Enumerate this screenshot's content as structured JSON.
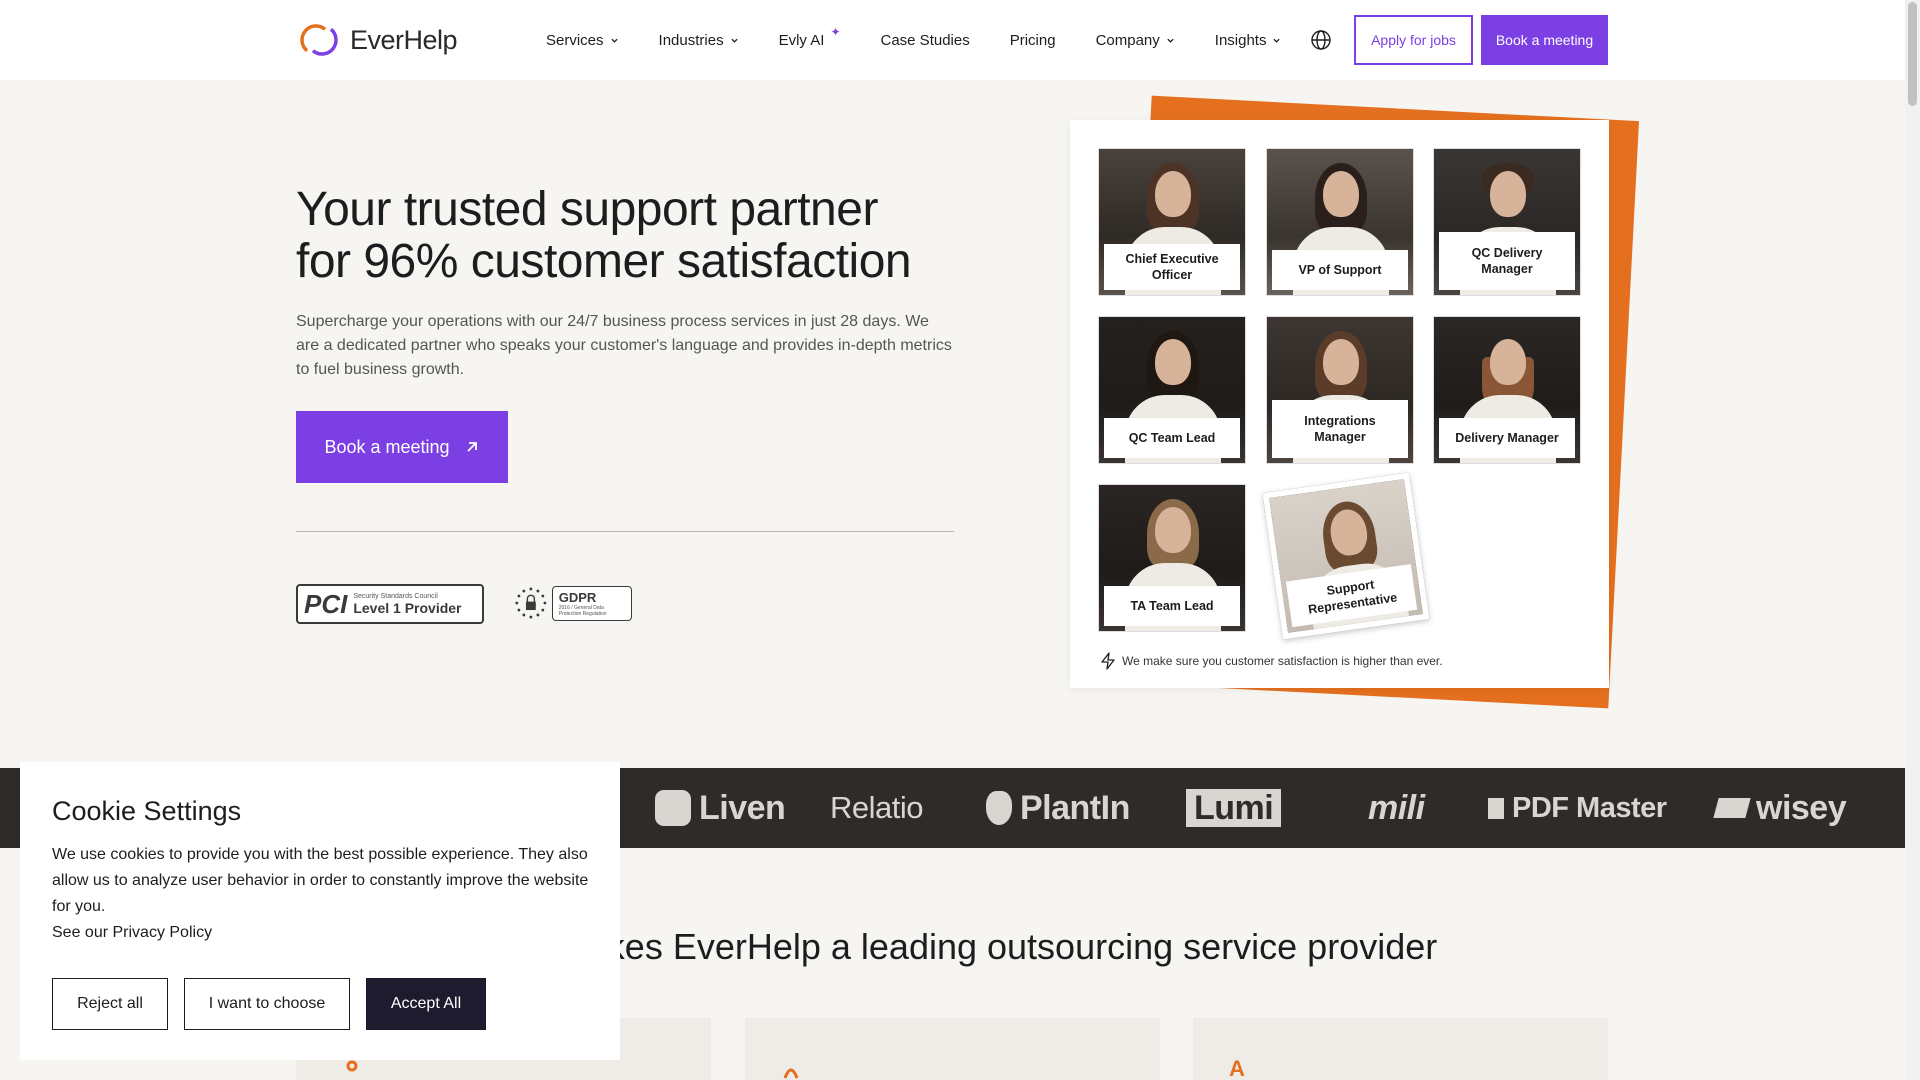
{
  "brand": {
    "name": "EverHelp",
    "accent": "#7b3fe4",
    "orange": "#e4701f"
  },
  "nav": {
    "items": [
      {
        "label": "Services",
        "dropdown": true
      },
      {
        "label": "Industries",
        "dropdown": true
      },
      {
        "label": "Evly AI",
        "dropdown": false
      },
      {
        "label": "Case Studies",
        "dropdown": false
      },
      {
        "label": "Pricing",
        "dropdown": false
      },
      {
        "label": "Company",
        "dropdown": true
      },
      {
        "label": "Insights",
        "dropdown": true
      }
    ],
    "apply_label": "Apply for jobs",
    "book_label": "Book a meeting"
  },
  "hero": {
    "title_line1": "Your trusted support partner",
    "title_line2": "for 96% customer satisfaction",
    "text": "Supercharge your operations with our 24/7 business process services in just 28 days. We are a dedicated partner who speaks your customer's language and provides in-depth metrics to fuel business growth.",
    "cta": "Book a meeting"
  },
  "badges": {
    "pci": {
      "mark": "PCI",
      "small": "Security Standards Council",
      "level": "Level 1 Provider"
    },
    "gdpr": {
      "title": "GDPR",
      "small": "2016 / General Data Protection Regulation"
    }
  },
  "team": {
    "members": [
      "Chief Executive Officer",
      "VP of Support",
      "QC Delivery Manager",
      "QC Team Lead",
      "Integrations Manager",
      "Delivery Manager",
      "TA Team Lead",
      "Support Representative"
    ],
    "note": "We make sure you customer satisfaction is higher than ever."
  },
  "client_logos": [
    "Liven",
    "Relatio",
    "PlantIn",
    "Lumi",
    "mili",
    "PDF Master",
    "wisey"
  ],
  "section": {
    "title": "What makes EverHelp a leading outsourcing service provider"
  },
  "cookie": {
    "title": "Cookie Settings",
    "text": "We use cookies to provide you with the best possible experience. They also allow us to analyze user behavior in order to constantly improve the website for you.",
    "link_prefix": "See our ",
    "link": "Privacy Policy",
    "reject": "Reject all",
    "choose": "I want to choose",
    "accept": "Accept All"
  }
}
